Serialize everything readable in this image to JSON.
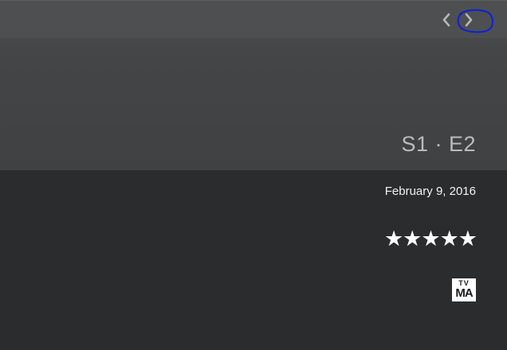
{
  "navigation": {
    "prev_icon": "chevron-left-icon",
    "next_icon": "chevron-right-icon",
    "highlight_color": "#0d1fd6"
  },
  "episode": {
    "label": "S1 · E2",
    "air_date": "February 9, 2016",
    "rating_stars": "★★★★★",
    "rating_value": 5,
    "rating_max": 5,
    "content_rating": {
      "top": "TV",
      "bottom": "MA"
    }
  },
  "colors": {
    "hero_background": "#45474a",
    "body_background": "#2b2c2d",
    "episode_text": "#b9bbbd",
    "primary_text": "#ffffff"
  }
}
